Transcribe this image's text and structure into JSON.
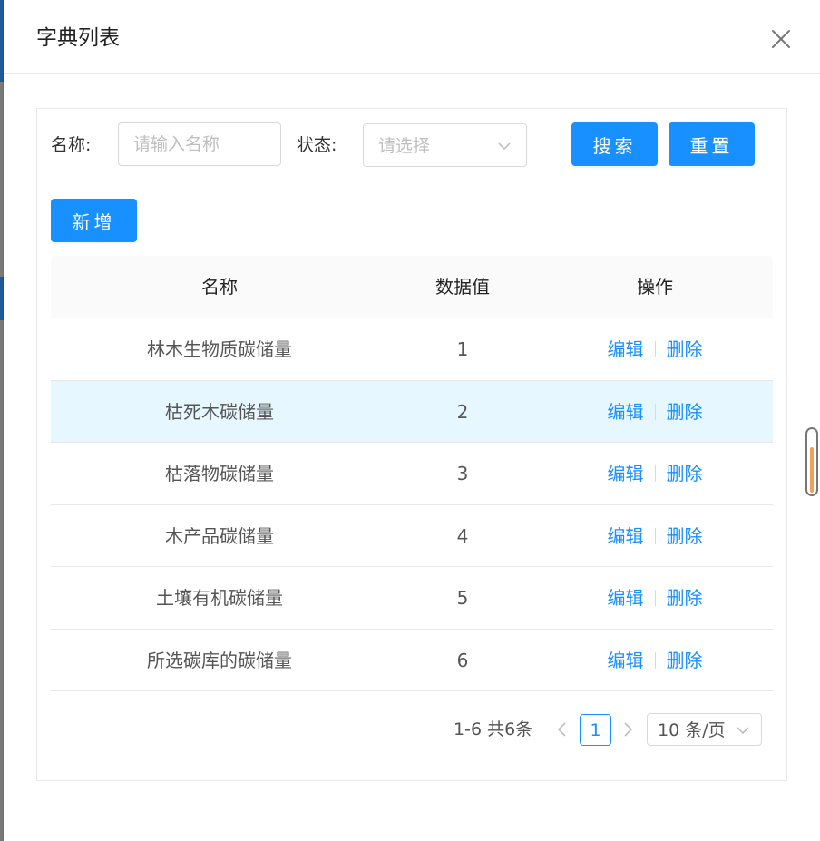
{
  "dialog": {
    "title": "字典列表"
  },
  "filter": {
    "name_label": "名称:",
    "name_placeholder": "请输入名称",
    "status_label": "状态:",
    "status_placeholder": "请选择",
    "search_label": "搜索",
    "reset_label": "重置"
  },
  "toolbar": {
    "add_label": "新增"
  },
  "table": {
    "columns": [
      "名称",
      "数据值",
      "操作"
    ],
    "rows": [
      {
        "name": "林木生物质碳储量",
        "value": "1",
        "edit": "编辑",
        "delete": "删除"
      },
      {
        "name": "枯死木碳储量",
        "value": "2",
        "edit": "编辑",
        "delete": "删除"
      },
      {
        "name": "枯落物碳储量",
        "value": "3",
        "edit": "编辑",
        "delete": "删除"
      },
      {
        "name": "木产品碳储量",
        "value": "4",
        "edit": "编辑",
        "delete": "删除"
      },
      {
        "name": "土壤有机碳储量",
        "value": "5",
        "edit": "编辑",
        "delete": "删除"
      },
      {
        "name": "所选碳库的碳储量",
        "value": "6",
        "edit": "编辑",
        "delete": "删除"
      }
    ]
  },
  "pagination": {
    "total_text": "1-6 共6条",
    "current_page": "1",
    "page_size": "10 条/页"
  },
  "colors": {
    "primary": "#1890ff",
    "row_hover": "#e6f7ff",
    "header_bg": "#fafafa",
    "border": "#e8e8e8"
  },
  "icons": {
    "close": "close-icon",
    "select_arrow": "chevron-down-icon",
    "prev": "chevron-left-icon",
    "next": "chevron-right-icon"
  }
}
